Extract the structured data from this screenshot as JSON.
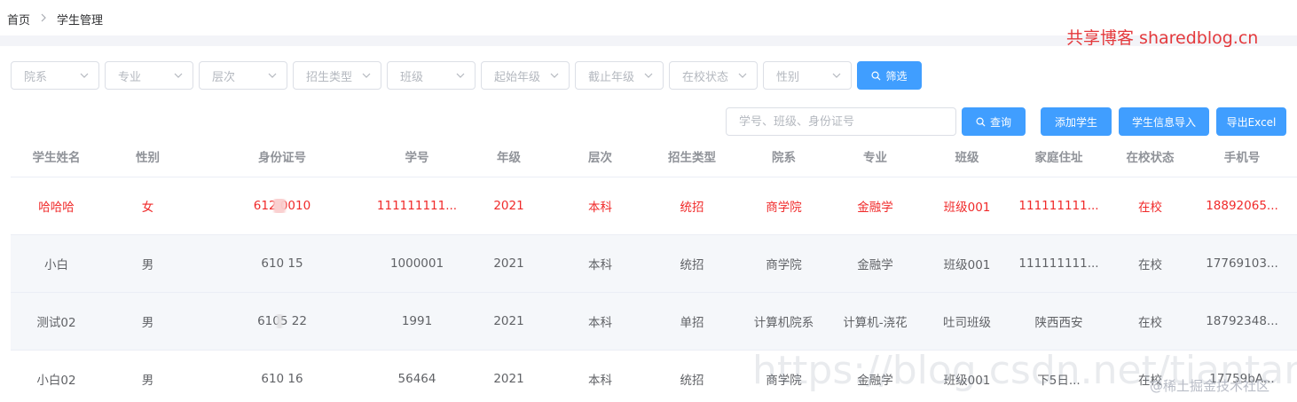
{
  "breadcrumb": {
    "home": "首页",
    "current": "学生管理"
  },
  "brand_mark": "共享博客 sharedblog.cn",
  "filters": [
    {
      "placeholder": "院系"
    },
    {
      "placeholder": "专业"
    },
    {
      "placeholder": "层次"
    },
    {
      "placeholder": "招生类型"
    },
    {
      "placeholder": "班级"
    },
    {
      "placeholder": "起始年级"
    },
    {
      "placeholder": "截止年级"
    },
    {
      "placeholder": "在校状态"
    },
    {
      "placeholder": "性别"
    }
  ],
  "filter_button": "筛选",
  "search": {
    "placeholder": "学号、班级、身份证号",
    "value": ""
  },
  "actions": {
    "query": "查询",
    "add": "添加学生",
    "import": "学生信息导入",
    "export": "导出Excel"
  },
  "table": {
    "headers": [
      "学生姓名",
      "性别",
      "身份证号",
      "学号",
      "年级",
      "层次",
      "招生类型",
      "院系",
      "专业",
      "班级",
      "家庭住址",
      "在校状态",
      "手机号"
    ],
    "rows": [
      [
        "哈哈哈",
        "女",
        "612              0010",
        "111111111...",
        "2021",
        "本科",
        "统招",
        "商学院",
        "金融学",
        "班级001",
        "111111111...",
        "在校",
        "18892065..."
      ],
      [
        "小白",
        "男",
        "610               15",
        "1000001",
        "2021",
        "本科",
        "统招",
        "商学院",
        "金融学",
        "班级001",
        "111111111...",
        "在校",
        "17769103..."
      ],
      [
        "测试02",
        "男",
        "6105              22",
        "1991",
        "2021",
        "本科",
        "单招",
        "计算机院系",
        "计算机-浇花",
        "吐司班级",
        "陕西西安",
        "在校",
        "18792348..."
      ],
      [
        "小白02",
        "男",
        "610               16",
        "56464",
        "2021",
        "本科",
        "统招",
        "商学院",
        "金融学",
        "班级001",
        "下5日...",
        "在校",
        "17759bA..."
      ]
    ]
  },
  "watermark": "@稀土掘金技术社区",
  "watermark_faint": "https://blog.csdn.net/tiantang1996",
  "colors": {
    "primary": "#409eff",
    "highlight_row": "#f02a2a",
    "brand_mark": "#e4393c"
  }
}
